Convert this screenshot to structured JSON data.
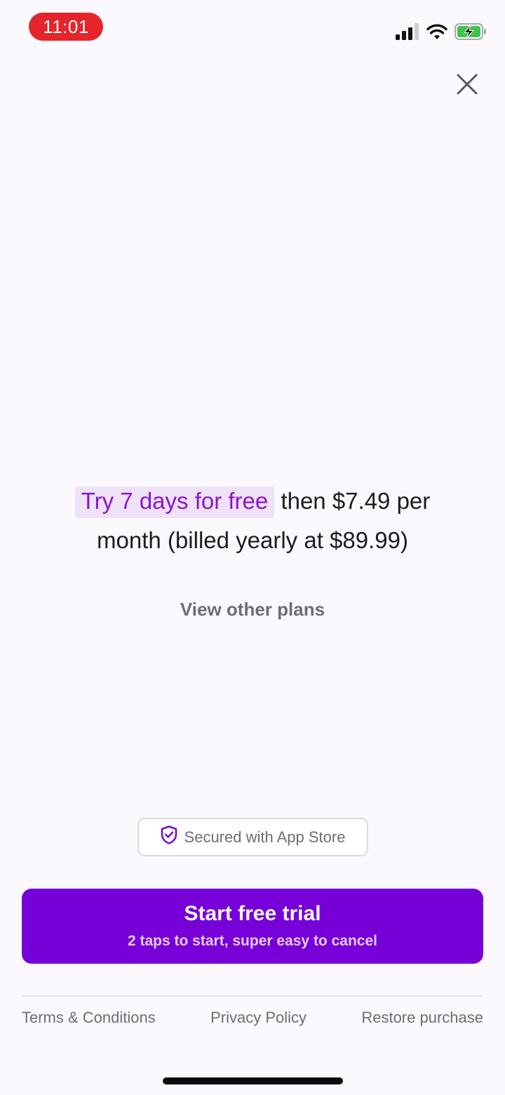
{
  "status_bar": {
    "time": "11:01",
    "time_pill_color": "#e5242b",
    "icons": [
      "signal-icon",
      "wifi-icon",
      "battery-charging-icon"
    ]
  },
  "close": {
    "icon": "close-icon"
  },
  "offer": {
    "highlight": "Try 7 days for free",
    "rest": " then $7.49 per month (billed yearly at $89.99)",
    "highlight_color": "#8a17c9",
    "highlight_bg": "#efe1f8"
  },
  "view_plans_label": "View other plans",
  "secured": {
    "icon": "shield-check-icon",
    "label": "Secured with App Store"
  },
  "cta": {
    "title": "Start free trial",
    "subtitle": "2 taps to start, super easy to cancel",
    "color": "#7700d9"
  },
  "footer": {
    "terms": "Terms & Conditions",
    "privacy": "Privacy Policy",
    "restore": "Restore purchase"
  }
}
